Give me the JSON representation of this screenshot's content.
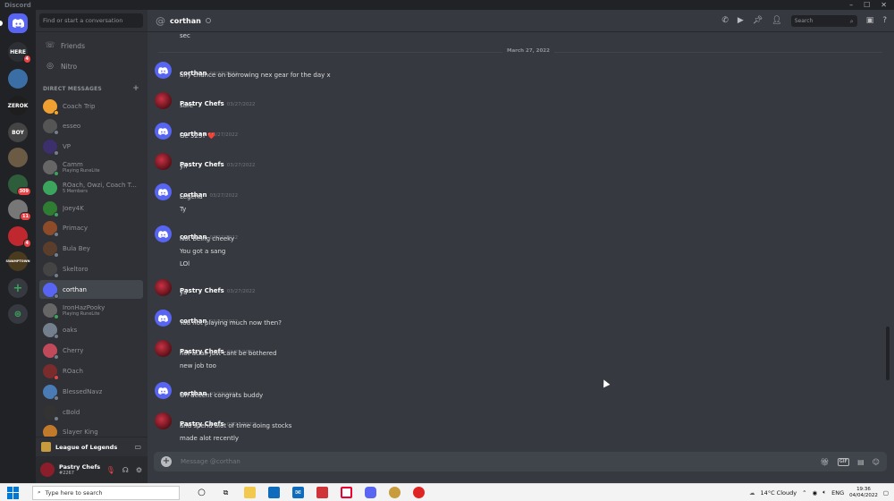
{
  "window": {
    "title": "Discord"
  },
  "servers": [
    {
      "label": "HERE",
      "color": "#2c2f33",
      "badge": "4"
    },
    {
      "label": "",
      "color": "#3a6ea5",
      "badge": ""
    },
    {
      "label": "ZEROK",
      "color": "#1e1e1e",
      "badge": ""
    },
    {
      "label": "BOY",
      "color": "#444",
      "badge": ""
    },
    {
      "label": "",
      "color": "#6b5b45",
      "badge": ""
    },
    {
      "label": "",
      "color": "#2e5d3b",
      "badge": "309"
    },
    {
      "label": "",
      "color": "#777",
      "badge": "11"
    },
    {
      "label": "",
      "color": "#c0282f",
      "badge": "4"
    },
    {
      "label": "SWAMPTOWN",
      "color": "#4b3b1e",
      "badge": ""
    }
  ],
  "sidebar": {
    "search_placeholder": "Find or start a conversation",
    "friends_label": "Friends",
    "nitro_label": "Nitro",
    "dm_header": "DIRECT MESSAGES",
    "dms": [
      {
        "name": "Coach Trip",
        "sub": "",
        "color": "#f0a030",
        "status": "idle"
      },
      {
        "name": "esseo",
        "sub": "",
        "color": "#555",
        "status": "off"
      },
      {
        "name": "VP",
        "sub": "",
        "color": "#3c2f6b",
        "status": "off"
      },
      {
        "name": "Camm",
        "sub": "Playing RuneLite",
        "color": "#666",
        "status": "on"
      },
      {
        "name": "ROach, Owzi, Coach T...",
        "sub": "5 Members",
        "color": "#3ba55d",
        "status": ""
      },
      {
        "name": "Joey4K",
        "sub": "",
        "color": "#2e7d32",
        "status": "on"
      },
      {
        "name": "Primacy",
        "sub": "",
        "color": "#8d4b2a",
        "status": "off"
      },
      {
        "name": "Bula Bey",
        "sub": "",
        "color": "#5a3e2b",
        "status": "off"
      },
      {
        "name": "Skeltoro",
        "sub": "",
        "color": "#444",
        "status": "off"
      },
      {
        "name": "corthan",
        "sub": "",
        "color": "#5865f2",
        "status": "off"
      },
      {
        "name": "IronHazPooky",
        "sub": "Playing RuneLite",
        "color": "#666",
        "status": "on"
      },
      {
        "name": "oaks",
        "sub": "",
        "color": "#747f8d",
        "status": "off"
      },
      {
        "name": "Cherry",
        "sub": "",
        "color": "#c04a5a",
        "status": "off"
      },
      {
        "name": "ROach",
        "sub": "",
        "color": "#7a2b2b",
        "status": "dnd"
      },
      {
        "name": "BlessedNavz",
        "sub": "",
        "color": "#4a7bb5",
        "status": "off"
      },
      {
        "name": "cBold",
        "sub": "",
        "color": "#333",
        "status": "off"
      },
      {
        "name": "Slayer King",
        "sub": "",
        "color": "#c07a2a",
        "status": "off"
      }
    ],
    "voice_channel": "League of Legends",
    "user": {
      "name": "Pastry Chefs",
      "tag": "#2267"
    }
  },
  "channel": {
    "name": "corthan",
    "search_placeholder": "Search"
  },
  "chat": {
    "top_line": "sec",
    "date_divider": "March 27, 2022",
    "messages": [
      {
        "author": "corthan",
        "avatar": "discord",
        "time": "03/27/2022",
        "lines": [
          "any chance on borrowing nex gear for the day x"
        ]
      },
      {
        "author": "Pastry Chefs",
        "avatar": "pastry",
        "time": "03/27/2022",
        "lines": [
          "sure"
        ]
      },
      {
        "author": "corthan",
        "avatar": "discord",
        "time": "03/27/2022",
        "lines": [
          "Ge 525? ❤️"
        ]
      },
      {
        "author": "Pastry Chefs",
        "avatar": "pastry",
        "time": "03/27/2022",
        "lines": [
          "yh"
        ]
      },
      {
        "author": "corthan",
        "avatar": "discord",
        "time": "03/27/2022",
        "lines": [
          "Legend",
          "Ty"
        ]
      },
      {
        "author": "corthan",
        "avatar": "discord",
        "time": "03/27/2022",
        "lines": [
          "Not being cheeky",
          "You got a sang",
          "LOl"
        ]
      },
      {
        "author": "Pastry Chefs",
        "avatar": "pastry",
        "time": "03/27/2022",
        "lines": [
          "ya"
        ]
      },
      {
        "author": "corthan",
        "avatar": "discord",
        "time": "03/27/2022",
        "lines": [
          "You not playing much now then?"
        ]
      },
      {
        "author": "Pastry Chefs",
        "avatar": "pastry",
        "time": "03/27/2022",
        "lines": [
          "not at all just cant be bothered",
          "new job too"
        ]
      },
      {
        "author": "corthan",
        "avatar": "discord",
        "time": "03/27/2022",
        "lines": [
          "Oh decent congrats buddy"
        ]
      },
      {
        "author": "Pastry Chefs",
        "avatar": "pastry",
        "time": "03/27/2022",
        "lines": [
          "and spend alot of time doing stocks",
          "made alot recently"
        ]
      }
    ]
  },
  "composer": {
    "placeholder": "Message @corthan",
    "gif_label": "GIF"
  },
  "taskbar": {
    "search_placeholder": "Type here to search",
    "weather": "14°C  Cloudy",
    "lang": "ENG",
    "time": "19:36",
    "date": "04/04/2022"
  }
}
